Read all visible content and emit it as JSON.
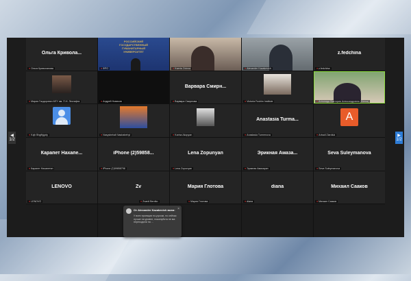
{
  "tiles": [
    {
      "name": "Ольга  Кривола...",
      "label": "Ольга Криволапова"
    },
    {
      "label": "ФРО"
    },
    {
      "label": "Ksenia Zotova"
    },
    {
      "label": "Alexander Kazakevich"
    },
    {
      "name": "z.fedchina",
      "label": "z.fedchina"
    },
    {
      "label": "Мария Гасдорович МГУ им. П.Н. Лесгафта"
    },
    {
      "label": "Андрей Новиков"
    },
    {
      "name": "Варвара  Смирн...",
      "label": "Варвара Смирнова"
    },
    {
      "label": "Victoria Fushim Institute"
    },
    {
      "label": "Антониди Виктория Александровна (Минск)"
    },
    {
      "label": "Kzjb Bhgfhjgxty"
    },
    {
      "label": "Nasysbehalt Nasbabehyt"
    },
    {
      "label": "Karina Akopyan"
    },
    {
      "name": "Anastasia  Turma...",
      "label": "Anastasia Turmenova"
    },
    {
      "letter": "A",
      "label": "Arbadi Ziardiuk"
    },
    {
      "name": "Карапет  Нахапе...",
      "label": "Карапет Нахапетян"
    },
    {
      "name": "iPhone (2)59858...",
      "label": "iPhone (2)59858798"
    },
    {
      "name": "Lena Zopunyan",
      "label": "Lena Zopunyan"
    },
    {
      "name": "Эрикная  Амаза...",
      "label": "Эрикная Амазарян"
    },
    {
      "name": "Seva Suleymanova",
      "label": "Seva Suleymanova"
    },
    {
      "name": "LENOVO",
      "label": "LENOVO"
    },
    {
      "name": "Zv",
      "label": "Zvardi Berdko"
    },
    {
      "name": "Мария  Глотова",
      "label": "Мария Глотова"
    },
    {
      "name": "diana",
      "label": "diana"
    },
    {
      "name": "Михаил  Сааков",
      "label": "Михаил Сааков"
    }
  ],
  "ranepa_text": "РОССИЙСКИЙ ГОСУДАРСТВЕННЫЙ ГУМАНИТАРНЫЙ УНИВЕРСИТЕТ",
  "toast": {
    "title": "От Alexander Kazakevich всем:",
    "text": "У всех проекции по-русски, но сейчас лучше на уровне, пожалуйста не ма переходили на ...",
    "close": "×"
  },
  "paging": {
    "left_page": "1/2",
    "right_page": "1/2"
  },
  "colors": {
    "active_speaker": "#8ddc3e",
    "mic_muted": "#ee3333"
  }
}
